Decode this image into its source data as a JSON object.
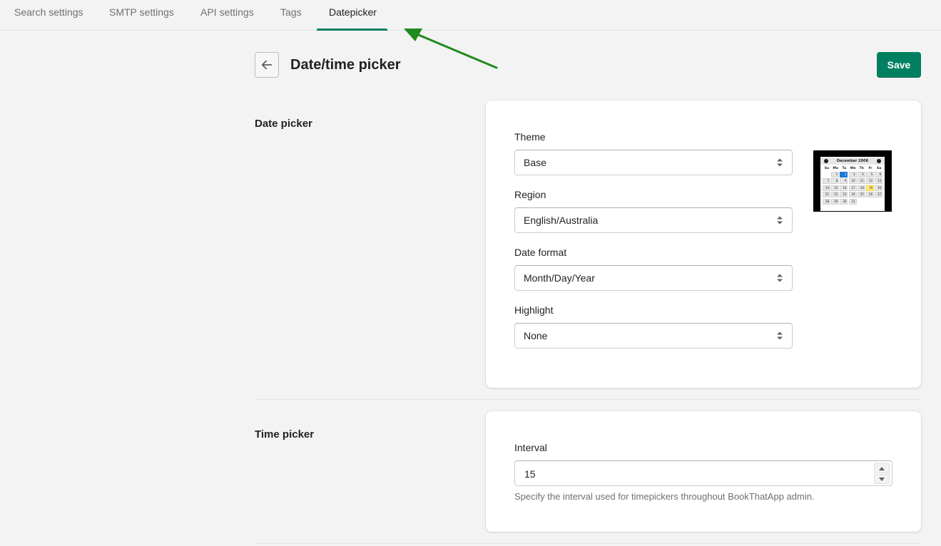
{
  "tabs": [
    {
      "label": "Search settings",
      "active": false
    },
    {
      "label": "SMTP settings",
      "active": false
    },
    {
      "label": "API settings",
      "active": false
    },
    {
      "label": "Tags",
      "active": false
    },
    {
      "label": "Datepicker",
      "active": true
    }
  ],
  "header": {
    "title": "Date/time picker",
    "save_label": "Save"
  },
  "date_picker": {
    "section_title": "Date picker",
    "fields": [
      {
        "label": "Theme",
        "value": "Base"
      },
      {
        "label": "Region",
        "value": "English/Australia"
      },
      {
        "label": "Date format",
        "value": "Month/Day/Year"
      },
      {
        "label": "Highlight",
        "value": "None"
      }
    ],
    "preview": {
      "month": "December 2008",
      "weekdays": [
        "Su",
        "Mo",
        "Tu",
        "We",
        "Th",
        "Fr",
        "Sa"
      ],
      "selected_day": "2",
      "highlighted_day": "19",
      "weeks": [
        [
          "",
          "1",
          "2",
          "3",
          "4",
          "5",
          "6"
        ],
        [
          "7",
          "8",
          "9",
          "10",
          "11",
          "12",
          "13"
        ],
        [
          "14",
          "15",
          "16",
          "17",
          "18",
          "19",
          "20"
        ],
        [
          "21",
          "22",
          "23",
          "24",
          "25",
          "26",
          "27"
        ],
        [
          "28",
          "29",
          "30",
          "31",
          "",
          "",
          ""
        ]
      ]
    }
  },
  "time_picker": {
    "section_title": "Time picker",
    "interval_label": "Interval",
    "interval_value": "15",
    "help_text": "Specify the interval used for timepickers throughout BookThatApp admin."
  },
  "colors": {
    "accent": "#008060",
    "annotation_arrow": "#1f8a1f"
  },
  "icons": {
    "back": "arrow-left-icon",
    "select_caret": "select-caret-icon",
    "spin_up": "chevron-up-icon",
    "spin_down": "chevron-down-icon"
  }
}
